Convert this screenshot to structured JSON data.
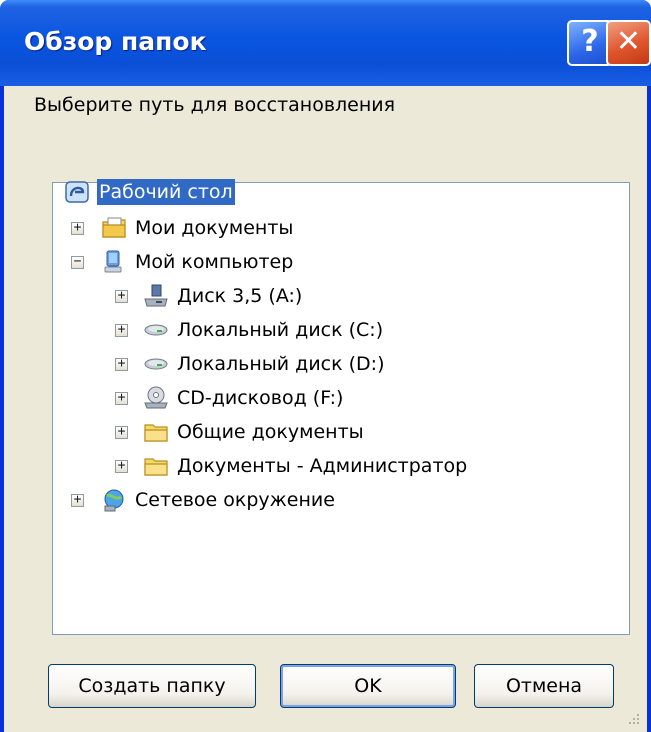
{
  "window": {
    "title": "Обзор папок",
    "help_glyph": "?",
    "close_glyph": "✕"
  },
  "prompt": "Выберите путь для восстановления",
  "tree": [
    {
      "label": "Рабочий стол",
      "icon": "desktop-icon",
      "selected": true
    },
    {
      "label": "Мои документы",
      "icon": "my-documents-icon",
      "expander": "+"
    },
    {
      "label": "Мой компьютер",
      "icon": "my-computer-icon",
      "expander": "−"
    },
    {
      "label": "Диск 3,5 (A:)",
      "icon": "floppy-drive-icon",
      "expander": "+"
    },
    {
      "label": "Локальный диск (C:)",
      "icon": "hard-drive-icon",
      "expander": "+"
    },
    {
      "label": "Локальный диск (D:)",
      "icon": "hard-drive-icon",
      "expander": "+"
    },
    {
      "label": "CD-дисковод (F:)",
      "icon": "cd-drive-icon",
      "expander": "+"
    },
    {
      "label": "Общие документы",
      "icon": "folder-icon",
      "expander": "+"
    },
    {
      "label": "Документы - Администратор",
      "icon": "folder-icon",
      "expander": "+"
    },
    {
      "label": "Сетевое окружение",
      "icon": "network-icon",
      "expander": "+"
    }
  ],
  "buttons": {
    "new_folder": "Создать папку",
    "ok": "OK",
    "cancel": "Отмена"
  }
}
